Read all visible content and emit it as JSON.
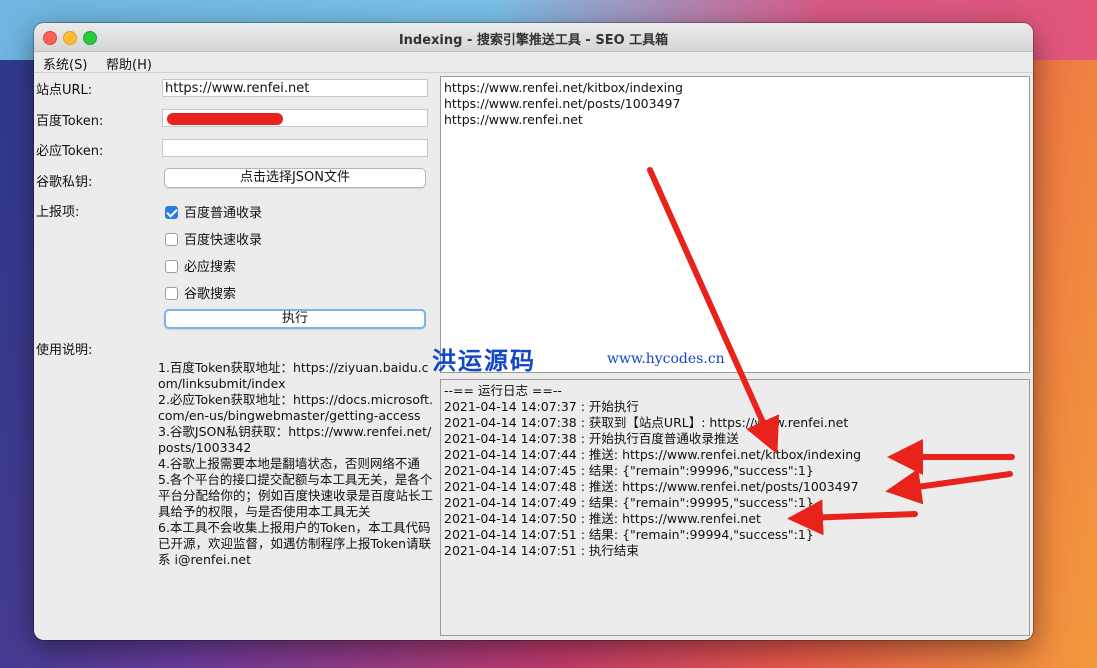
{
  "window": {
    "title": "Indexing - 搜索引擎推送工具 - SEO 工具箱"
  },
  "menu": {
    "system": "系统(S)",
    "help": "帮助(H)"
  },
  "form": {
    "site_url_label": "站点URL:",
    "site_url_value": "https://www.renfei.net",
    "baidu_token_label": "百度Token:",
    "bing_token_label": "必应Token:",
    "bing_token_value": "",
    "google_key_label": "谷歌私钥:",
    "google_key_button": "点击选择JSON文件",
    "report_label": "上报项:",
    "options": [
      {
        "label": "百度普通收录",
        "checked": true
      },
      {
        "label": "百度快速收录",
        "checked": false
      },
      {
        "label": "必应搜索",
        "checked": false
      },
      {
        "label": "谷歌搜索",
        "checked": false
      }
    ],
    "execute_button": "执行",
    "usage_label": "使用说明:"
  },
  "instructions": [
    "1.百度Token获取地址：https://ziyuan.baidu.com/linksubmit/index",
    "2.必应Token获取地址：https://docs.microsoft.com/en-us/bingwebmaster/getting-access",
    "3.谷歌JSON私钥获取：https://www.renfei.net/posts/1003342",
    "4.谷歌上报需要本地是翻墙状态，否则网络不通",
    "5.各个平台的接口提交配额与本工具无关，是各个平台分配给你的；例如百度快速收录是百度站长工具给予的权限，与是否使用本工具无关",
    "6.本工具不会收集上报用户的Token，本工具代码已开源，欢迎监督，如遇仿制程序上报Token请联系 i@renfei.net"
  ],
  "urls": [
    "https://www.renfei.net/kitbox/indexing",
    "https://www.renfei.net/posts/1003497",
    "https://www.renfei.net"
  ],
  "log": [
    "--== 运行日志 ==--",
    "2021-04-14 14:07:37 : 开始执行",
    "2021-04-14 14:07:38 : 获取到【站点URL】: https://www.renfei.net",
    "2021-04-14 14:07:38 : 开始执行百度普通收录推送",
    "2021-04-14 14:07:44 : 推送: https://www.renfei.net/kitbox/indexing",
    "2021-04-14 14:07:45 : 结果: {\"remain\":99996,\"success\":1}",
    "2021-04-14 14:07:48 : 推送: https://www.renfei.net/posts/1003497",
    "2021-04-14 14:07:49 : 结果: {\"remain\":99995,\"success\":1}",
    "2021-04-14 14:07:50 : 推送: https://www.renfei.net",
    "2021-04-14 14:07:51 : 结果: {\"remain\":99994,\"success\":1}",
    "2021-04-14 14:07:51 : 执行结束"
  ],
  "watermark": {
    "cn": "洪运源码",
    "en": "www.hycodes.cn"
  },
  "colors": {
    "annotation_arrow": "#e8231c",
    "checkbox_checked": "#2a7de1"
  }
}
